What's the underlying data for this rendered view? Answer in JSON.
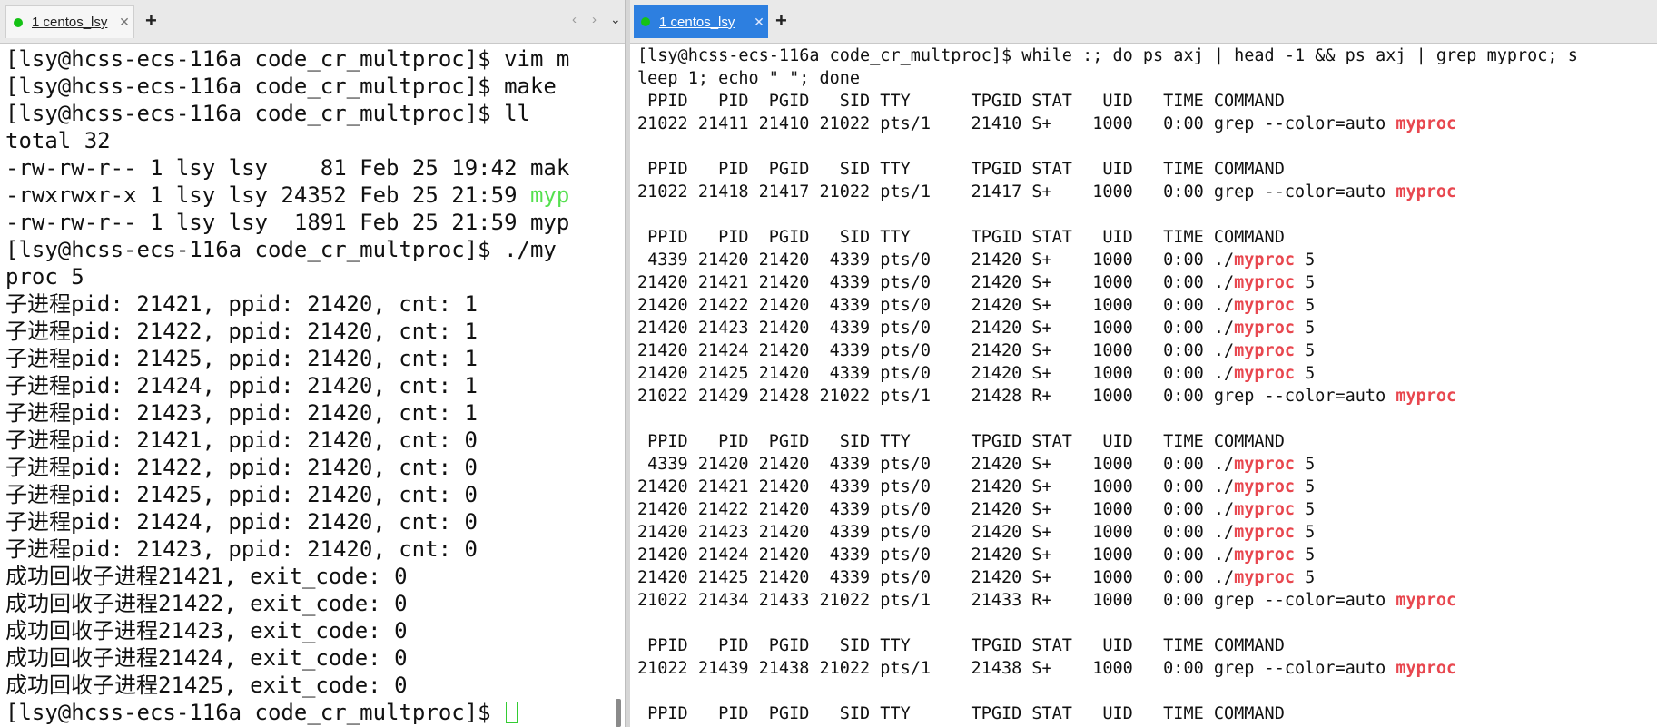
{
  "left": {
    "tab_label": "1 centos_lsy",
    "tab_close": "✕",
    "new_tab": "+",
    "nav_prev": "‹",
    "nav_next": "›",
    "nav_menu": "⌄",
    "lines": [
      [
        {
          "t": "[lsy@hcss-ecs-116a code_cr_multproc]$ vim m"
        }
      ],
      [
        {
          "t": "[lsy@hcss-ecs-116a code_cr_multproc]$ make"
        }
      ],
      [
        {
          "t": "[lsy@hcss-ecs-116a code_cr_multproc]$ ll"
        }
      ],
      [
        {
          "t": "total 32"
        }
      ],
      [
        {
          "t": "-rw-rw-r-- 1 lsy lsy    81 Feb 25 19:42 mak"
        }
      ],
      [
        {
          "t": "-rwxrwxr-x 1 lsy lsy 24352 Feb 25 21:59 "
        },
        {
          "t": "myp",
          "c": "green"
        }
      ],
      [
        {
          "t": "-rw-rw-r-- 1 lsy lsy  1891 Feb 25 21:59 myp"
        }
      ],
      [
        {
          "t": "[lsy@hcss-ecs-116a code_cr_multproc]$ ./my"
        }
      ],
      [
        {
          "t": "proc 5"
        }
      ],
      [
        {
          "t": "子进程pid: 21421, ppid: 21420, cnt: 1"
        }
      ],
      [
        {
          "t": "子进程pid: 21422, ppid: 21420, cnt: 1"
        }
      ],
      [
        {
          "t": "子进程pid: 21425, ppid: 21420, cnt: 1"
        }
      ],
      [
        {
          "t": "子进程pid: 21424, ppid: 21420, cnt: 1"
        }
      ],
      [
        {
          "t": "子进程pid: 21423, ppid: 21420, cnt: 1"
        }
      ],
      [
        {
          "t": "子进程pid: 21421, ppid: 21420, cnt: 0"
        }
      ],
      [
        {
          "t": "子进程pid: 21422, ppid: 21420, cnt: 0"
        }
      ],
      [
        {
          "t": "子进程pid: 21425, ppid: 21420, cnt: 0"
        }
      ],
      [
        {
          "t": "子进程pid: 21424, ppid: 21420, cnt: 0"
        }
      ],
      [
        {
          "t": "子进程pid: 21423, ppid: 21420, cnt: 0"
        }
      ],
      [
        {
          "t": "成功回收子进程21421, exit_code: 0"
        }
      ],
      [
        {
          "t": "成功回收子进程21422, exit_code: 0"
        }
      ],
      [
        {
          "t": "成功回收子进程21423, exit_code: 0"
        }
      ],
      [
        {
          "t": "成功回收子进程21424, exit_code: 0"
        }
      ],
      [
        {
          "t": "成功回收子进程21425, exit_code: 0"
        }
      ],
      [
        {
          "t": "[lsy@hcss-ecs-116a code_cr_multproc]$ "
        },
        {
          "cursor": true
        }
      ]
    ]
  },
  "right": {
    "tab_label": "1 centos_lsy",
    "tab_close": "✕",
    "new_tab": "+",
    "lines": [
      [
        {
          "t": "[lsy@hcss-ecs-116a code_cr_multproc]$ while :; do ps axj | head -1 && ps axj | grep myproc; s"
        }
      ],
      [
        {
          "t": "leep 1; echo \" \"; done"
        }
      ],
      [
        {
          "t": " PPID   PID  PGID   SID TTY      TPGID STAT   UID   TIME COMMAND"
        }
      ],
      [
        {
          "t": "21022 21411 21410 21022 pts/1    21410 S+    1000   0:00 grep --color=auto "
        },
        {
          "t": "myproc",
          "c": "red"
        }
      ],
      [
        {
          "t": " "
        }
      ],
      [
        {
          "t": " PPID   PID  PGID   SID TTY      TPGID STAT   UID   TIME COMMAND"
        }
      ],
      [
        {
          "t": "21022 21418 21417 21022 pts/1    21417 S+    1000   0:00 grep --color=auto "
        },
        {
          "t": "myproc",
          "c": "red"
        }
      ],
      [
        {
          "t": " "
        }
      ],
      [
        {
          "t": " PPID   PID  PGID   SID TTY      TPGID STAT   UID   TIME COMMAND"
        }
      ],
      [
        {
          "t": " 4339 21420 21420  4339 pts/0    21420 S+    1000   0:00 ./"
        },
        {
          "t": "myproc",
          "c": "red"
        },
        {
          "t": " 5"
        }
      ],
      [
        {
          "t": "21420 21421 21420  4339 pts/0    21420 S+    1000   0:00 ./"
        },
        {
          "t": "myproc",
          "c": "red"
        },
        {
          "t": " 5"
        }
      ],
      [
        {
          "t": "21420 21422 21420  4339 pts/0    21420 S+    1000   0:00 ./"
        },
        {
          "t": "myproc",
          "c": "red"
        },
        {
          "t": " 5"
        }
      ],
      [
        {
          "t": "21420 21423 21420  4339 pts/0    21420 S+    1000   0:00 ./"
        },
        {
          "t": "myproc",
          "c": "red"
        },
        {
          "t": " 5"
        }
      ],
      [
        {
          "t": "21420 21424 21420  4339 pts/0    21420 S+    1000   0:00 ./"
        },
        {
          "t": "myproc",
          "c": "red"
        },
        {
          "t": " 5"
        }
      ],
      [
        {
          "t": "21420 21425 21420  4339 pts/0    21420 S+    1000   0:00 ./"
        },
        {
          "t": "myproc",
          "c": "red"
        },
        {
          "t": " 5"
        }
      ],
      [
        {
          "t": "21022 21429 21428 21022 pts/1    21428 R+    1000   0:00 grep --color=auto "
        },
        {
          "t": "myproc",
          "c": "red"
        }
      ],
      [
        {
          "t": " "
        }
      ],
      [
        {
          "t": " PPID   PID  PGID   SID TTY      TPGID STAT   UID   TIME COMMAND"
        }
      ],
      [
        {
          "t": " 4339 21420 21420  4339 pts/0    21420 S+    1000   0:00 ./"
        },
        {
          "t": "myproc",
          "c": "red"
        },
        {
          "t": " 5"
        }
      ],
      [
        {
          "t": "21420 21421 21420  4339 pts/0    21420 S+    1000   0:00 ./"
        },
        {
          "t": "myproc",
          "c": "red"
        },
        {
          "t": " 5"
        }
      ],
      [
        {
          "t": "21420 21422 21420  4339 pts/0    21420 S+    1000   0:00 ./"
        },
        {
          "t": "myproc",
          "c": "red"
        },
        {
          "t": " 5"
        }
      ],
      [
        {
          "t": "21420 21423 21420  4339 pts/0    21420 S+    1000   0:00 ./"
        },
        {
          "t": "myproc",
          "c": "red"
        },
        {
          "t": " 5"
        }
      ],
      [
        {
          "t": "21420 21424 21420  4339 pts/0    21420 S+    1000   0:00 ./"
        },
        {
          "t": "myproc",
          "c": "red"
        },
        {
          "t": " 5"
        }
      ],
      [
        {
          "t": "21420 21425 21420  4339 pts/0    21420 S+    1000   0:00 ./"
        },
        {
          "t": "myproc",
          "c": "red"
        },
        {
          "t": " 5"
        }
      ],
      [
        {
          "t": "21022 21434 21433 21022 pts/1    21433 R+    1000   0:00 grep --color=auto "
        },
        {
          "t": "myproc",
          "c": "red"
        }
      ],
      [
        {
          "t": " "
        }
      ],
      [
        {
          "t": " PPID   PID  PGID   SID TTY      TPGID STAT   UID   TIME COMMAND"
        }
      ],
      [
        {
          "t": "21022 21439 21438 21022 pts/1    21438 S+    1000   0:00 grep --color=auto "
        },
        {
          "t": "myproc",
          "c": "red"
        }
      ],
      [
        {
          "t": " "
        }
      ],
      [
        {
          "t": " PPID   PID  PGID   SID TTY      TPGID STAT   UID   TIME COMMAND"
        }
      ]
    ]
  },
  "colors": {
    "prompt_green": "#55e04f",
    "match_red": "#e8474f",
    "active_tab": "#2d7fe0",
    "status_dot": "#15c215"
  }
}
